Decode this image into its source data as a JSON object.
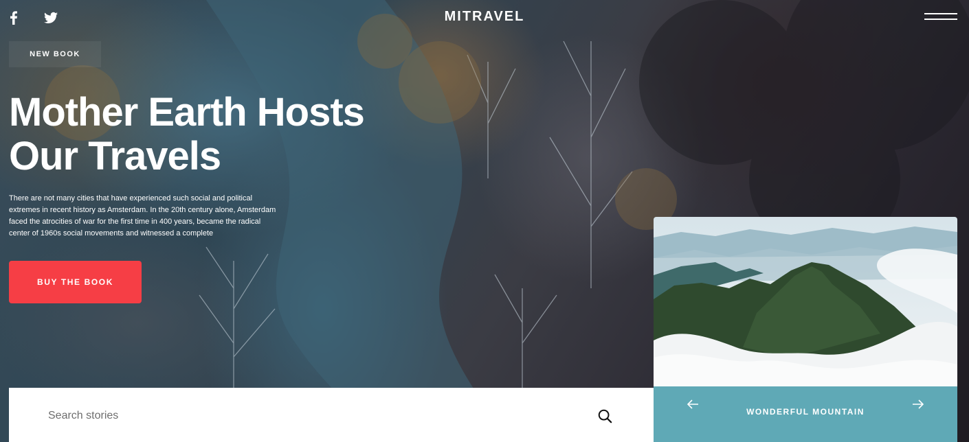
{
  "header": {
    "logo": "MITRAVEL",
    "social": [
      "facebook-icon",
      "twitter-icon"
    ],
    "menu_icon": "hamburger-menu-icon"
  },
  "hero": {
    "badge": "NEW BOOK",
    "title_lines": [
      "Mother Earth Hosts",
      "Our Travels"
    ],
    "description_lines": [
      "There are not many cities that have experienced such social and political",
      "extremes in recent history as Amsterdam. In the 20th century alone, Amsterdam",
      "faced the atrocities of war for the first time in 400 years, became the radical",
      "center of 1960s social movements and witnessed a complete"
    ],
    "cta_label": "BUY THE BOOK",
    "cta_color": "#f63e45"
  },
  "search": {
    "placeholder": "Search stories",
    "value": "",
    "icon": "search-icon"
  },
  "slider": {
    "title": "WONDERFUL MOUNTAIN",
    "footer_color": "#5fa9b6",
    "prev_icon": "arrow-left-icon",
    "next_icon": "arrow-right-icon"
  }
}
